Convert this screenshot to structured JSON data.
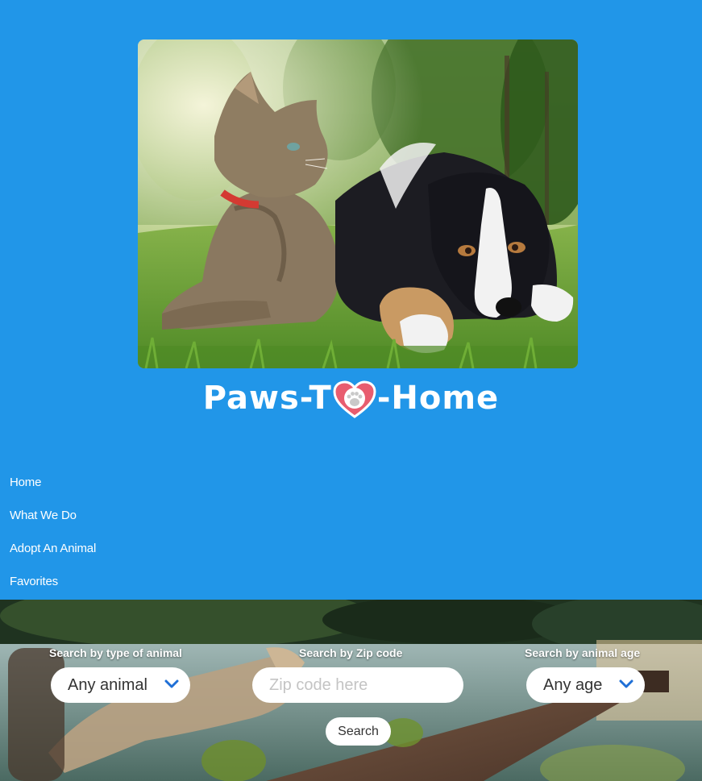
{
  "logo": {
    "text_before": "Paws-T",
    "text_after": "-Home",
    "heart_icon": "heart-paw-icon",
    "heart_color": "#e85d6f"
  },
  "nav": {
    "items": [
      {
        "label": "Home"
      },
      {
        "label": "What We Do"
      },
      {
        "label": "Adopt An Animal"
      },
      {
        "label": "Favorites"
      }
    ]
  },
  "search": {
    "animal_type": {
      "label": "Search by type of animal",
      "value": "Any animal"
    },
    "zip": {
      "label": "Search by Zip code",
      "placeholder": "Zip code here"
    },
    "age": {
      "label": "Search by animal age",
      "value": "Any age"
    },
    "button_label": "Search"
  },
  "colors": {
    "background": "#2196e8",
    "chevron": "#1f6fd6"
  }
}
